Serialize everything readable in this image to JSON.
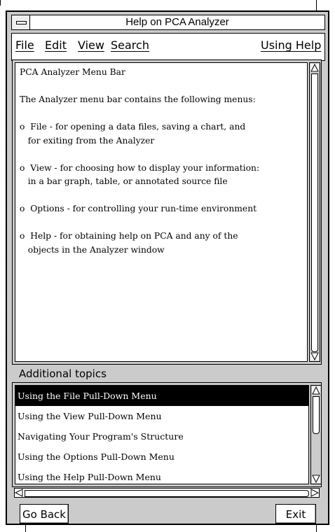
{
  "window": {
    "title": "Help on PCA Analyzer"
  },
  "menubar": {
    "file": "File",
    "edit": "Edit",
    "view": "View",
    "search": "Search",
    "using_help": "Using Help"
  },
  "help_text": {
    "body": "PCA Analyzer Menu Bar\n\nThe Analyzer menu bar contains the following menus:\n\no  File - for opening a data files, saving a chart, and\n   for exiting from the Analyzer\n\no  View - for choosing how to display your information:\n   in a bar graph, table, or annotated source file\n\no  Options - for controlling your run-time environment\n\no  Help - for obtaining help on PCA and any of the\n   objects in the Analyzer window"
  },
  "topics": {
    "label": "Additional topics",
    "items": [
      {
        "label": "Using the File Pull-Down Menu",
        "selected": true
      },
      {
        "label": "Using the View Pull-Down Menu",
        "selected": false
      },
      {
        "label": "Navigating Your Program's Structure",
        "selected": false
      },
      {
        "label": "Using the Options Pull-Down Menu",
        "selected": false
      },
      {
        "label": "Using the Help Pull-Down Menu",
        "selected": false
      }
    ]
  },
  "buttons": {
    "go_back": "Go Back",
    "exit": "Exit"
  },
  "icons": {
    "window_menu": "window-menu-icon",
    "scroll_up": "scroll-up-arrow-icon",
    "scroll_down": "scroll-down-arrow-icon",
    "scroll_left": "scroll-left-arrow-icon",
    "scroll_right": "scroll-right-arrow-icon"
  },
  "colors": {
    "selection_bg": "#000000",
    "selection_fg": "#ffffff",
    "frame_gray": "#d6d6d6"
  }
}
